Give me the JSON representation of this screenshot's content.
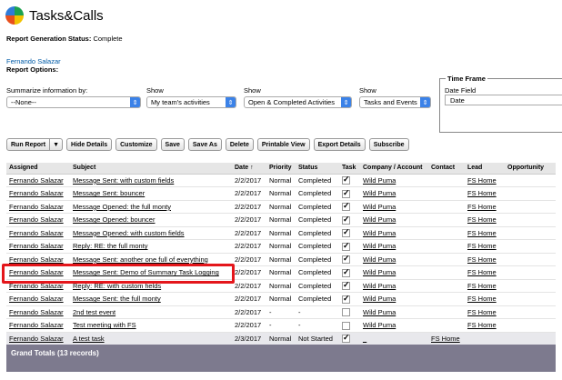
{
  "app": {
    "title": "Tasks&Calls"
  },
  "report_status": {
    "label": "Report Generation Status:",
    "value": "Complete"
  },
  "user": "Fernando Salazar",
  "report_options_label": "Report Options:",
  "filters": {
    "summarize": {
      "label": "Summarize information by:",
      "value": "--None--"
    },
    "show1": {
      "label": "Show",
      "value": "My team's activities"
    },
    "show2": {
      "label": "Show",
      "value": "Open & Completed Activities"
    },
    "show3": {
      "label": "Show",
      "value": "Tasks and Events"
    }
  },
  "time_frame": {
    "legend": "Time Frame",
    "date_field_label": "Date Field",
    "date_field_value": "Date"
  },
  "toolbar": {
    "run_report": "Run Report",
    "hide_details": "Hide Details",
    "customize": "Customize",
    "save": "Save",
    "save_as": "Save As",
    "delete": "Delete",
    "printable_view": "Printable View",
    "export_details": "Export Details",
    "subscribe": "Subscribe"
  },
  "columns": [
    "Assigned",
    "Subject",
    "Date ↑",
    "Priority",
    "Status",
    "Task",
    "Company / Account",
    "Contact",
    "Lead",
    "Opportunity"
  ],
  "rows": [
    {
      "assigned": "Fernando Salazar",
      "subject": "Message Sent: with custom fields",
      "date": "2/2/2017",
      "priority": "Normal",
      "status": "Completed",
      "task": true,
      "company": "Wild Puma",
      "contact": "",
      "lead": "FS Home"
    },
    {
      "assigned": "Fernando Salazar",
      "subject": "Message Sent: bouncer",
      "date": "2/2/2017",
      "priority": "Normal",
      "status": "Completed",
      "task": true,
      "company": "Wild Puma",
      "contact": "",
      "lead": "FS Home"
    },
    {
      "assigned": "Fernando Salazar",
      "subject": "Message Opened: the full monty",
      "date": "2/2/2017",
      "priority": "Normal",
      "status": "Completed",
      "task": true,
      "company": "Wild Puma",
      "contact": "",
      "lead": "FS Home"
    },
    {
      "assigned": "Fernando Salazar",
      "subject": "Message Opened: bouncer",
      "date": "2/2/2017",
      "priority": "Normal",
      "status": "Completed",
      "task": true,
      "company": "Wild Puma",
      "contact": "",
      "lead": "FS Home"
    },
    {
      "assigned": "Fernando Salazar",
      "subject": "Message Opened: with custom fields",
      "date": "2/2/2017",
      "priority": "Normal",
      "status": "Completed",
      "task": true,
      "company": "Wild Puma",
      "contact": "",
      "lead": "FS Home"
    },
    {
      "assigned": "Fernando Salazar",
      "subject": "Reply: RE: the full monty",
      "date": "2/2/2017",
      "priority": "Normal",
      "status": "Completed",
      "task": true,
      "company": "Wild Puma",
      "contact": "",
      "lead": "FS Home"
    },
    {
      "assigned": "Fernando Salazar",
      "subject": "Message Sent: another one full of everything",
      "date": "2/2/2017",
      "priority": "Normal",
      "status": "Completed",
      "task": true,
      "company": "Wild Puma",
      "contact": "",
      "lead": "FS Home"
    },
    {
      "assigned": "Fernando Salazar",
      "subject": "Message Sent: Demo of Summary Task Logging",
      "date": "2/2/2017",
      "priority": "Normal",
      "status": "Completed",
      "task": true,
      "company": "Wild Puma",
      "contact": "",
      "lead": "FS Home"
    },
    {
      "assigned": "Fernando Salazar",
      "subject": "Reply: RE: with custom fields",
      "date": "2/2/2017",
      "priority": "Normal",
      "status": "Completed",
      "task": true,
      "company": "Wild Puma",
      "contact": "",
      "lead": "FS Home"
    },
    {
      "assigned": "Fernando Salazar",
      "subject": "Message Sent: the full monty",
      "date": "2/2/2017",
      "priority": "Normal",
      "status": "Completed",
      "task": true,
      "company": "Wild Puma",
      "contact": "",
      "lead": "FS Home"
    },
    {
      "assigned": "Fernando Salazar",
      "subject": "2nd test event",
      "date": "2/2/2017",
      "priority": "-",
      "status": "-",
      "task": false,
      "company": "Wild Puma",
      "contact": "",
      "lead": "FS Home"
    },
    {
      "assigned": "Fernando Salazar",
      "subject": "Test meeting with FS",
      "date": "2/2/2017",
      "priority": "-",
      "status": "-",
      "task": false,
      "company": "Wild Puma",
      "contact": "",
      "lead": "FS Home"
    },
    {
      "assigned": "Fernando Salazar",
      "subject": "A test task",
      "date": "2/3/2017",
      "priority": "Normal",
      "status": "Not Started",
      "task": true,
      "company": "_",
      "contact": "FS Home",
      "lead": ""
    }
  ],
  "grand_totals": "Grand Totals (13 records)"
}
